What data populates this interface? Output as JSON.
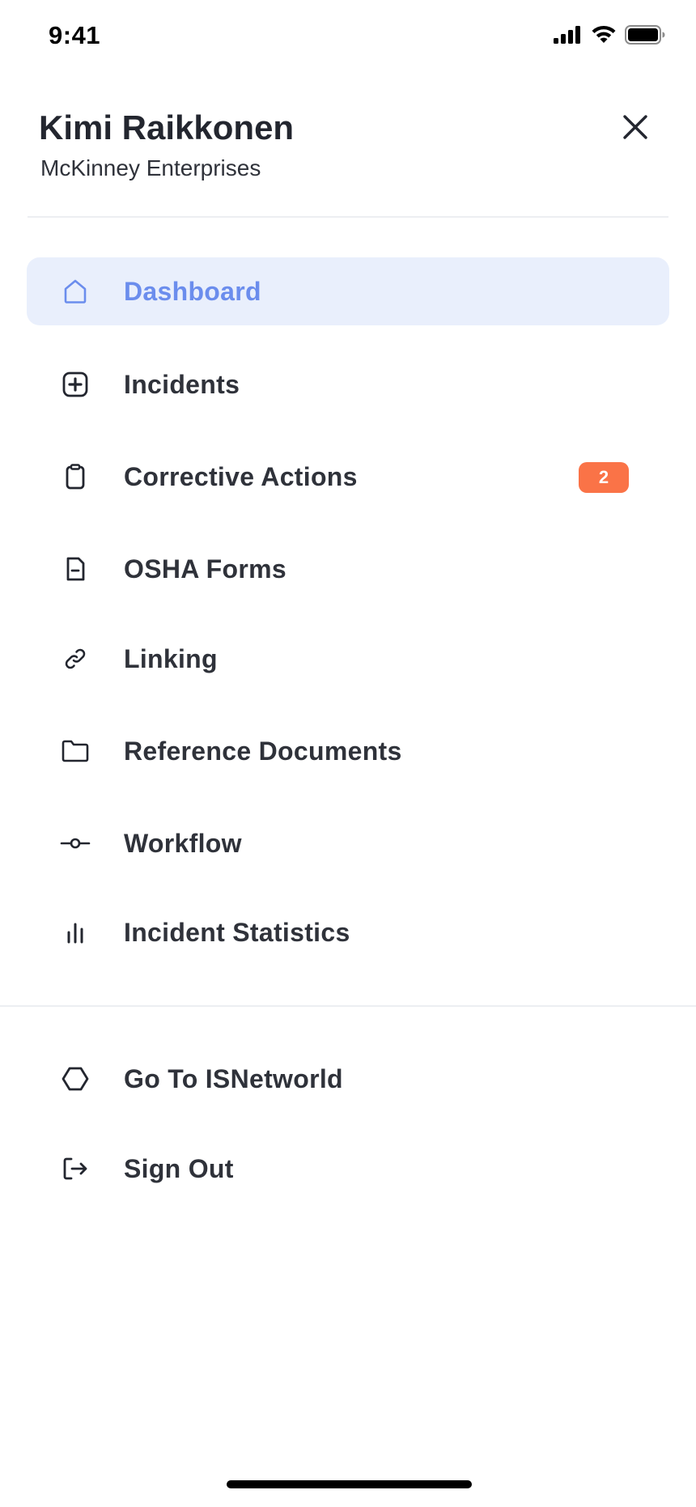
{
  "status_bar": {
    "time": "9:41"
  },
  "header": {
    "user_name": "Kimi Raikkonen",
    "organization": "McKinney Enterprises"
  },
  "menu": {
    "primary": [
      {
        "label": "Dashboard",
        "icon": "home-icon",
        "active": true
      },
      {
        "label": "Incidents",
        "icon": "plus-square-icon"
      },
      {
        "label": "Corrective Actions",
        "icon": "clipboard-icon",
        "badge": "2"
      },
      {
        "label": "OSHA Forms",
        "icon": "document-icon"
      },
      {
        "label": "Linking",
        "icon": "link-icon"
      },
      {
        "label": "Reference Documents",
        "icon": "folder-icon"
      },
      {
        "label": "Workflow",
        "icon": "commit-icon"
      },
      {
        "label": "Incident Statistics",
        "icon": "bar-chart-icon"
      }
    ],
    "secondary": [
      {
        "label": "Go To ISNetworld",
        "icon": "hexagon-icon"
      },
      {
        "label": "Sign Out",
        "icon": "sign-out-icon"
      }
    ]
  },
  "colors": {
    "accent": "#6b8ded",
    "active_background": "#e9effc",
    "badge": "#fa7347",
    "text": "#2f323a"
  }
}
